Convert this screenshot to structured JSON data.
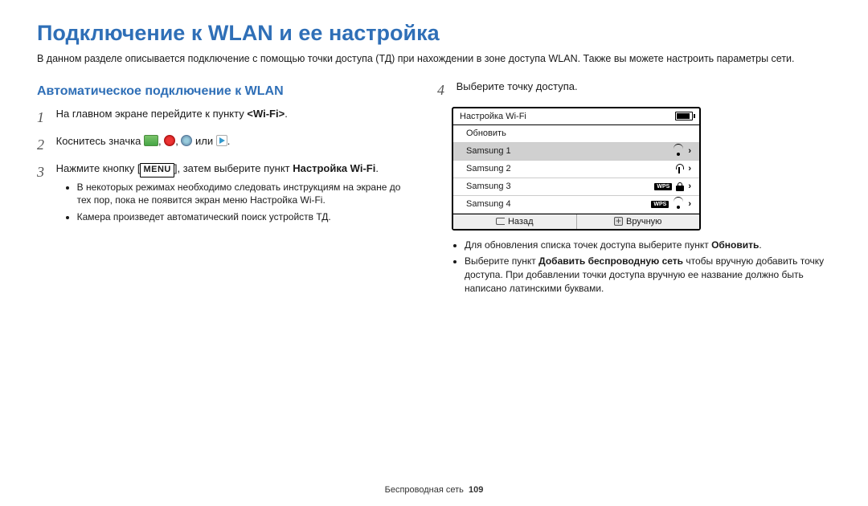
{
  "title": "Подключение к WLAN и ее настройка",
  "intro": "В данном разделе описывается подключение с помощью точки доступа (ТД) при нахождении в зоне доступа WLAN. Также вы можете настроить параметры сети.",
  "left": {
    "subtitle": "Автоматическое подключение к WLAN",
    "step1_pre": "На главном экране перейдите к пункту ",
    "step1_bold": "<Wi-Fi>",
    "step1_post": ".",
    "step2_pre": "Коснитесь значка ",
    "step2_mid": ", ",
    "step2_or": " или ",
    "step2_post": ".",
    "step3_pre": "Нажмите кнопку [",
    "step3_menu": "MENU",
    "step3_mid": "], затем выберите пункт ",
    "step3_bold": "Настройка Wi-Fi",
    "step3_post": ".",
    "step3_b1": "В некоторых режимах необходимо следовать инструкциям на экране до тех пор, пока не появится экран меню Настройка Wi-Fi.",
    "step3_b2": "Камера произведет автоматический поиск устройств ТД."
  },
  "right": {
    "step4": "Выберите точку доступа.",
    "note1_pre": "Для обновления списка точек доступа выберите пункт ",
    "note1_bold": "Обновить",
    "note1_post": ".",
    "note2_pre": "Выберите пункт ",
    "note2_bold": "Добавить беспроводную сеть",
    "note2_post": " чтобы вручную добавить точку доступа. При добавлении точки доступа вручную ее название должно быть написано латинскими буквами."
  },
  "device": {
    "title": "Настройка Wi-Fi",
    "refresh": "Обновить",
    "rows": [
      "Samsung 1",
      "Samsung 2",
      "Samsung 3",
      "Samsung 4"
    ],
    "back": "Назад",
    "manual": "Вручную"
  },
  "footer_label": "Беспроводная сеть",
  "footer_page": "109"
}
